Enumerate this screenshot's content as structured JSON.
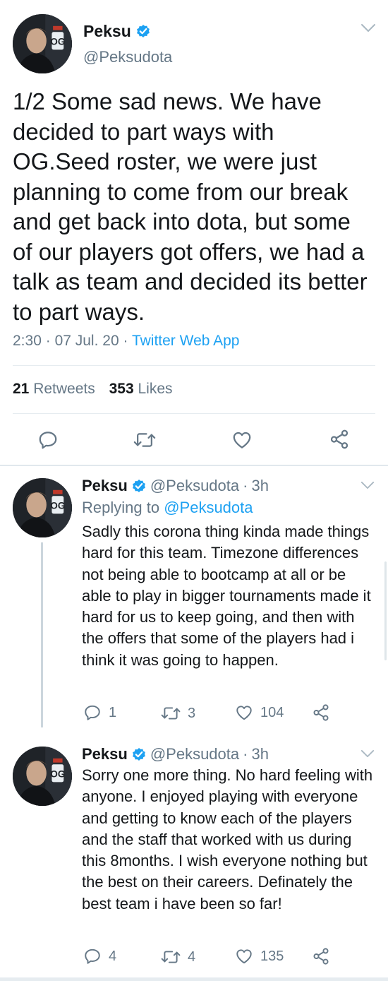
{
  "main_tweet": {
    "name": "Peksu",
    "handle": "@Peksudota",
    "text": "1/2 Some sad news. We have decided to part ways with OG.Seed roster, we were just planning to come from our break and get back into dota, but some of our players got offers, we had a talk as team and decided its better to part ways.",
    "time": "2:30",
    "date": "07 Jul. 20",
    "separator": "·",
    "source": "Twitter Web App",
    "retweets_count": "21",
    "retweets_label": "Retweets",
    "likes_count": "353",
    "likes_label": "Likes"
  },
  "replies": [
    {
      "name": "Peksu",
      "handle": "@Peksudota",
      "separator": "·",
      "age": "3h",
      "replying_label": "Replying to",
      "replying_to": "@Peksudota",
      "text": "Sadly this corona thing kinda made things hard for this team. Timezone differences not being able to bootcamp at all or be able to play in bigger tournaments made it hard for us to keep going, and then with the offers that some of the players had i think it was going to happen.",
      "reply_count": "1",
      "retweet_count": "3",
      "like_count": "104"
    },
    {
      "name": "Peksu",
      "handle": "@Peksudota",
      "separator": "·",
      "age": "3h",
      "text": "Sorry one more thing. No hard feeling with anyone. I enjoyed playing with everyone and getting to know each of the players and the staff that worked with us during this 8months. I wish everyone nothing but the best on their careers. Definately the best team i have been so far!",
      "reply_count": "4",
      "retweet_count": "4",
      "like_count": "135"
    }
  ],
  "icons": {
    "verified": "verified-badge-icon",
    "more": "chevron-down-icon",
    "reply": "reply-icon",
    "retweet": "retweet-icon",
    "like": "heart-icon",
    "share": "share-icon"
  },
  "colors": {
    "accent": "#1da1f2",
    "text": "#14171a",
    "secondary": "#657786",
    "divider": "#e6ecf0"
  }
}
